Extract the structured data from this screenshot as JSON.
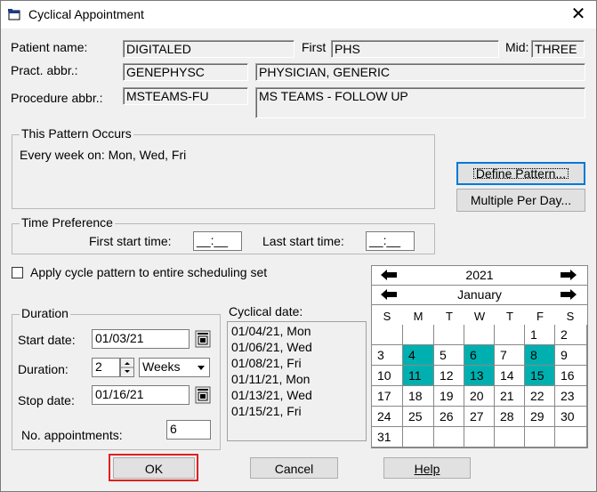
{
  "window": {
    "title": "Cyclical Appointment",
    "close_glyph": "✕"
  },
  "patient": {
    "name_label": "Patient name:",
    "name_value": "DIGITALED",
    "first_label": "First",
    "first_value": "PHS",
    "mid_label": "Mid:",
    "mid_value": "THREE"
  },
  "pract": {
    "label": "Pract. abbr.:",
    "abbr": "GENEPHYSC",
    "full": "PHYSICIAN, GENERIC"
  },
  "procedure": {
    "label": "Procedure abbr.:",
    "abbr": "MSTEAMS-FU",
    "full": "MS TEAMS - FOLLOW UP"
  },
  "pattern": {
    "title": "This Pattern Occurs",
    "text": "Every week on: Mon, Wed, Fri"
  },
  "buttons": {
    "define_pattern": "Define Pattern...",
    "multiple_per_day": "Multiple Per Day...",
    "ok": "OK",
    "cancel": "Cancel",
    "help": "Help"
  },
  "time_pref": {
    "title": "Time Preference",
    "first_label": "First start time:",
    "first_value": "__:__",
    "last_label": "Last start time:",
    "last_value": "__:__"
  },
  "apply_checkbox": {
    "label": "Apply cycle pattern to entire scheduling set",
    "checked": false
  },
  "duration": {
    "title": "Duration",
    "start_label": "Start date:",
    "start_value": "01/03/21",
    "duration_label": "Duration:",
    "duration_value": "2",
    "unit": "Weeks",
    "stop_label": "Stop date:",
    "stop_value": "01/16/21",
    "nappts_label": "No. appointments:",
    "nappts_value": "6"
  },
  "cyclical": {
    "label": "Cyclical date:",
    "dates": [
      "01/04/21, Mon",
      "01/06/21, Wed",
      "01/08/21, Fri",
      "01/11/21, Mon",
      "01/13/21, Wed",
      "01/15/21, Fri"
    ]
  },
  "calendar": {
    "year": "2021",
    "month": "January",
    "weekdays": [
      "S",
      "M",
      "T",
      "W",
      "T",
      "F",
      "S"
    ],
    "weeks": [
      [
        "",
        "",
        "",
        "",
        "",
        "1",
        "2"
      ],
      [
        "3",
        "4",
        "5",
        "6",
        "7",
        "8",
        "9"
      ],
      [
        "10",
        "11",
        "12",
        "13",
        "14",
        "15",
        "16"
      ],
      [
        "17",
        "18",
        "19",
        "20",
        "21",
        "22",
        "23"
      ],
      [
        "24",
        "25",
        "26",
        "27",
        "28",
        "29",
        "30"
      ],
      [
        "31",
        "",
        "",
        "",
        "",
        "",
        ""
      ]
    ],
    "highlighted": [
      "4",
      "6",
      "8",
      "11",
      "13",
      "15"
    ],
    "highlight_color": "#00b0b0"
  }
}
